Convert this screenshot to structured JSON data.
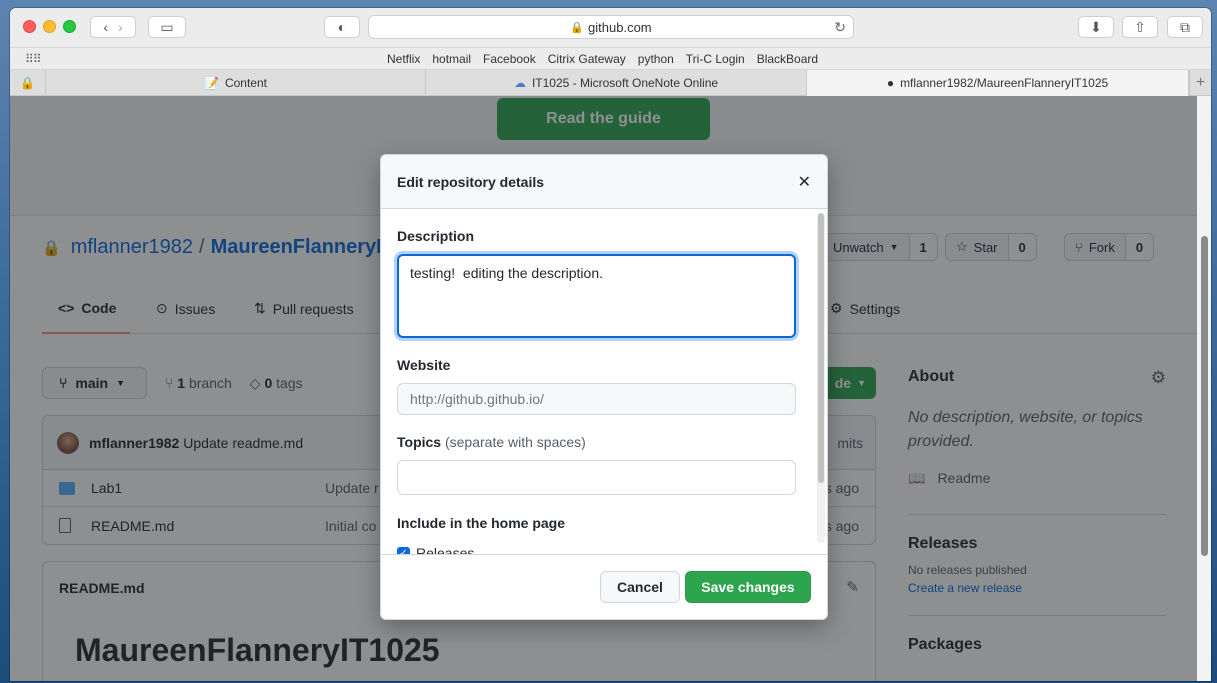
{
  "browser": {
    "url": "github.com",
    "favorites": [
      "Netflix",
      "hotmail",
      "Facebook",
      "Citrix Gateway",
      "python",
      "Tri-C Login",
      "BlackBoard"
    ],
    "tabs": [
      {
        "label": "Content",
        "icon": "pencil-icon"
      },
      {
        "label": "IT1025 - Microsoft OneNote Online",
        "icon": "cloud-icon"
      },
      {
        "label": "mflanner1982/MaureenFlanneryIT1025",
        "icon": "github-icon"
      }
    ]
  },
  "page": {
    "guide_button": "Read the guide",
    "owner": "mflanner1982",
    "slash": "/",
    "repo": "MaureenFlanneryIT",
    "actions": {
      "unwatch_label": "Unwatch",
      "unwatch_count": "1",
      "star_label": "Star",
      "star_count": "0",
      "fork_label": "Fork",
      "fork_count": "0"
    },
    "nav": {
      "code": "Code",
      "issues": "Issues",
      "pulls": "Pull requests",
      "settings": "Settings"
    },
    "branch": "main",
    "branch_count": "1",
    "branch_word": "branch",
    "tag_count": "0",
    "tag_word": "tags",
    "code_button": "de",
    "commit": {
      "author": "mflanner1982",
      "message": "Update readme.md",
      "right": "mits"
    },
    "files": [
      {
        "name": "Lab1",
        "message": "Update r",
        "age": "s ago"
      },
      {
        "name": "README.md",
        "message": "Initial co",
        "age": "s ago"
      }
    ],
    "readme": {
      "header": "README.md",
      "title": "MaureenFlanneryIT1025"
    },
    "about": {
      "heading": "About",
      "description": "No description, website, or topics provided.",
      "readme": "Readme",
      "releases_heading": "Releases",
      "no_releases": "No releases published",
      "create_release": "Create a new release",
      "packages_heading": "Packages"
    }
  },
  "modal": {
    "title": "Edit repository details",
    "description_label": "Description",
    "description_value": "testing!  editing the description.",
    "website_label": "Website",
    "website_placeholder": "http://github.github.io/",
    "topics_label": "Topics",
    "topics_note": "(separate with spaces)",
    "home_label": "Include in the home page",
    "releases_check": "Releases",
    "cancel": "Cancel",
    "save": "Save changes"
  }
}
